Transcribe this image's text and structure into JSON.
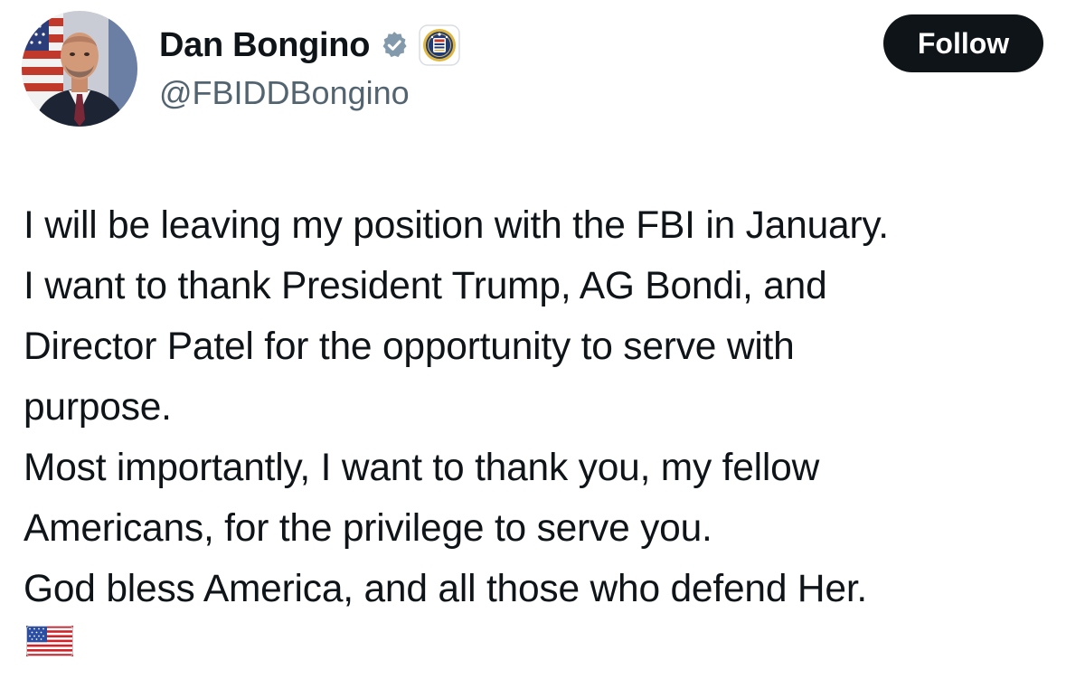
{
  "author": {
    "display_name": "Dan Bongino",
    "handle": "@FBIDDBongino",
    "avatar_icon": "profile-photo",
    "verified_badge_icon": "verified-check-icon",
    "affiliation_badge_icon": "fbi-seal-icon"
  },
  "actions": {
    "follow_label": "Follow"
  },
  "post": {
    "lines": [
      "I will be leaving my position with the FBI in January.",
      "I want to thank President Trump, AG Bondi, and",
      "Director Patel for the opportunity to serve with",
      "purpose.",
      "Most importantly, I want to thank you, my fellow",
      "Americans, for the privilege to serve you.",
      "God bless America, and all those who defend Her."
    ],
    "trailing_emoji": "us-flag-emoji"
  },
  "colors": {
    "text_primary": "#0f1419",
    "text_secondary": "#536471",
    "button_bg": "#0f1419",
    "button_text": "#ffffff",
    "verified_badge": "#829aab",
    "background": "#ffffff"
  }
}
